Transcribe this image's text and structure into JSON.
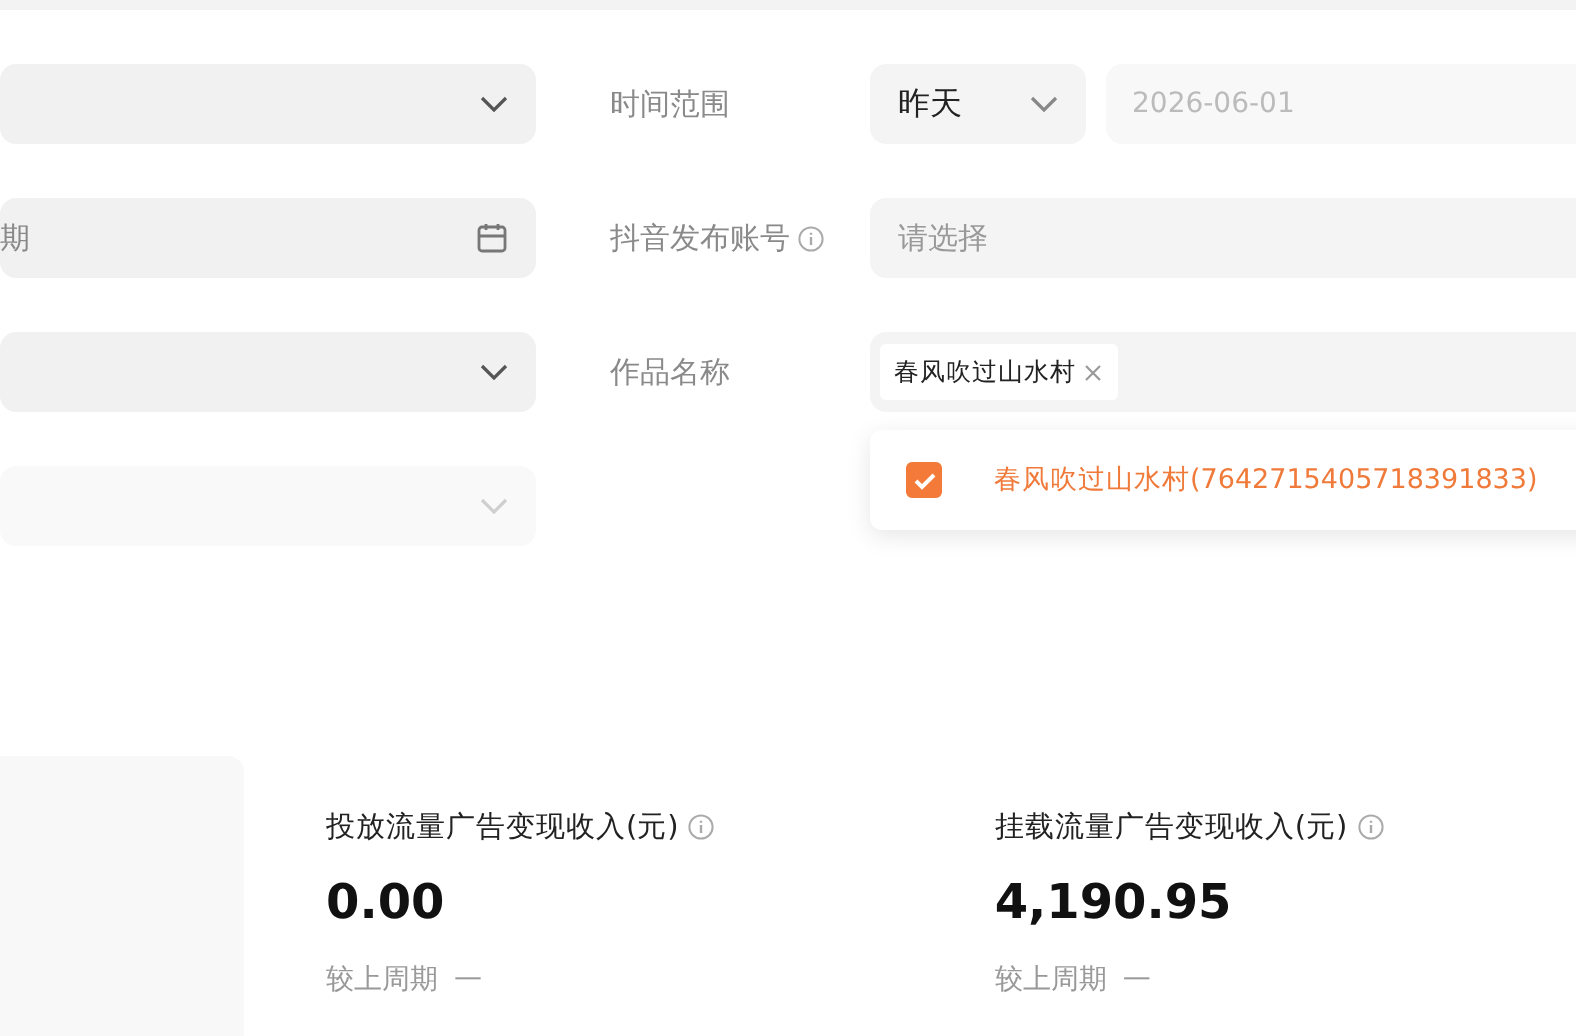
{
  "left_filters": [
    {
      "kind": "select",
      "disabled": false
    },
    {
      "kind": "date",
      "placeholder": "期"
    },
    {
      "kind": "select",
      "disabled": false
    },
    {
      "kind": "select",
      "disabled": true
    }
  ],
  "time_range": {
    "label": "时间范围",
    "preset": "昨天",
    "date_placeholder": "2026-06-01"
  },
  "account": {
    "label": "抖音发布账号",
    "placeholder": "请选择"
  },
  "work": {
    "label": "作品名称",
    "tags": [
      {
        "text": "春风吹过山水村"
      }
    ],
    "options": [
      {
        "text": "春风吹过山水村(7642715405718391833)",
        "checked": true
      }
    ]
  },
  "metrics": [
    {
      "title": "投放流量广告变现收入(元)",
      "value": "0.00",
      "compare_label": "较上周期",
      "compare_value": "—"
    },
    {
      "title": "挂载流量广告变现收入(元)",
      "value": "4,190.95",
      "compare_label": "较上周期",
      "compare_value": "—"
    }
  ]
}
